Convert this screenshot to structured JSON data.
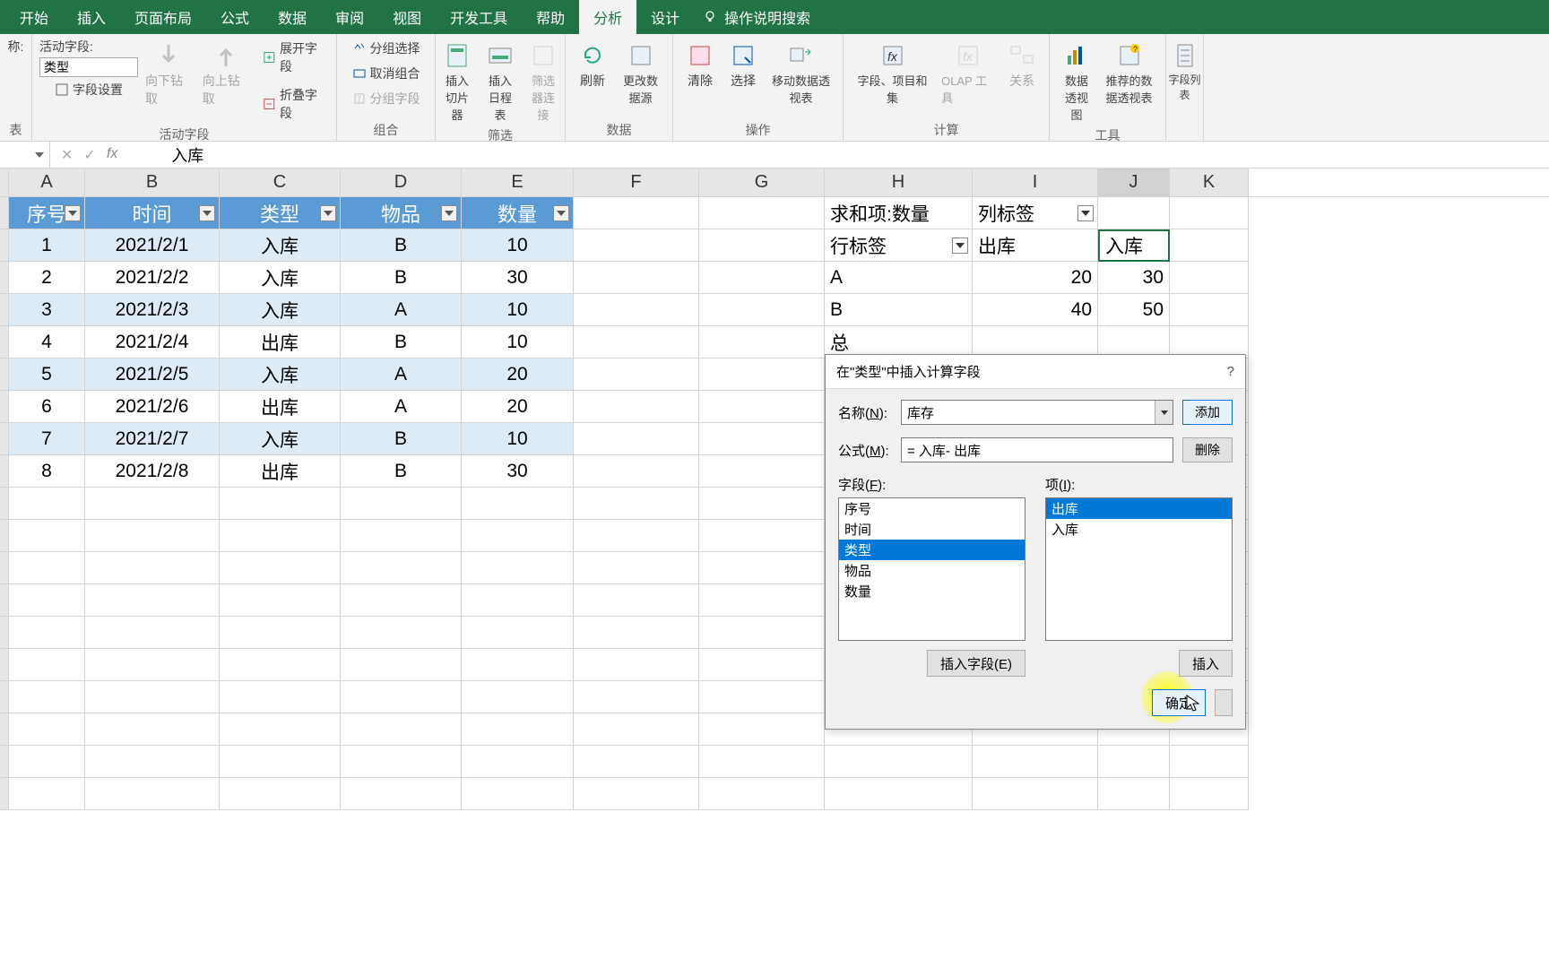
{
  "ribbon": {
    "tabs": [
      "开始",
      "插入",
      "页面布局",
      "公式",
      "数据",
      "审阅",
      "视图",
      "开发工具",
      "帮助",
      "分析",
      "设计"
    ],
    "active_tab": "分析",
    "tell_me": "操作说明搜索",
    "active_field_label": "活动字段:",
    "name_label": "称:",
    "active_field_value": "类型",
    "field_settings": "字段设置",
    "drill_down": "向下钻取",
    "drill_up": "向上钻取",
    "expand_field": "展开字段",
    "collapse_field": "折叠字段",
    "group_active": "活动字段",
    "group_sel": "分组选择",
    "ungroup": "取消组合",
    "group_field": "分组字段",
    "group_group": "组合",
    "slicer": "插入切片器",
    "timeline": "插入日程表",
    "filter_conn": "筛选器连接",
    "group_filter": "筛选",
    "refresh": "刷新",
    "change_source": "更改数据源",
    "group_data": "数据",
    "clear": "清除",
    "select": "选择",
    "move_pivot": "移动数据透视表",
    "group_action": "操作",
    "fields_calc": "字段、项目和集",
    "olap": "OLAP 工具",
    "relations": "关系",
    "group_calc": "计算",
    "pivot_chart": "数据透视图",
    "recommend": "推荐的数据透视表",
    "group_tools": "工具",
    "field_list": "字段列表",
    "group_table": "表"
  },
  "formula_bar": {
    "value": "入库",
    "fx": "fx"
  },
  "columns": [
    "A",
    "B",
    "C",
    "D",
    "E",
    "F",
    "G",
    "H",
    "I",
    "J",
    "K"
  ],
  "table_headers": [
    "序号",
    "时间",
    "类型",
    "物品",
    "数量"
  ],
  "table_rows": [
    [
      "1",
      "2021/2/1",
      "入库",
      "B",
      "10"
    ],
    [
      "2",
      "2021/2/2",
      "入库",
      "B",
      "30"
    ],
    [
      "3",
      "2021/2/3",
      "入库",
      "A",
      "10"
    ],
    [
      "4",
      "2021/2/4",
      "出库",
      "B",
      "10"
    ],
    [
      "5",
      "2021/2/5",
      "入库",
      "A",
      "20"
    ],
    [
      "6",
      "2021/2/6",
      "出库",
      "A",
      "20"
    ],
    [
      "7",
      "2021/2/7",
      "入库",
      "B",
      "10"
    ],
    [
      "8",
      "2021/2/8",
      "出库",
      "B",
      "30"
    ]
  ],
  "pivot": {
    "sum_field": "求和项:数量",
    "col_labels": "列标签",
    "row_labels": "行标签",
    "out": "出库",
    "in": "入库",
    "rows": [
      {
        "label": "A",
        "out": "20",
        "in": "30"
      },
      {
        "label": "B",
        "out": "40",
        "in": "50"
      }
    ],
    "total_prefix": "总"
  },
  "dialog": {
    "title": "在\"类型\"中插入计算字段",
    "help": "?",
    "name_label": "名称(N):",
    "name_value": "库存",
    "formula_label": "公式(M):",
    "formula_value": "= 入库- 出库",
    "add_btn": "添加",
    "del_btn": "删除",
    "fields_label": "字段(F):",
    "fields": [
      "序号",
      "时间",
      "类型",
      "物品",
      "数量"
    ],
    "fields_selected": "类型",
    "items_label": "项(I):",
    "items": [
      "出库",
      "入库"
    ],
    "items_selected": "出库",
    "insert_field_btn": "插入字段(E)",
    "insert_item_btn": "插入",
    "ok_btn": "确定",
    "cancel_btn": ""
  }
}
